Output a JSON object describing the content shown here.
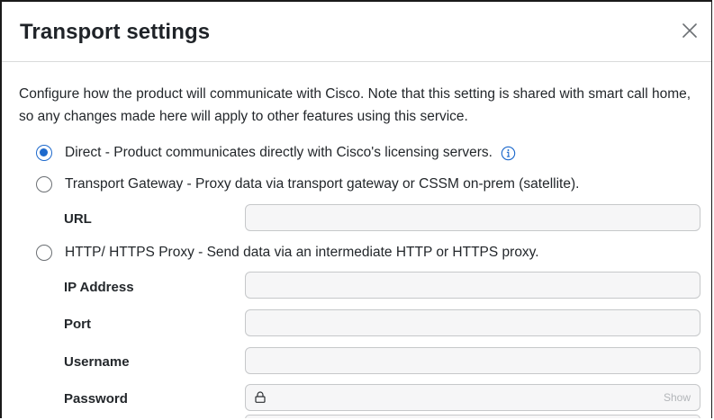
{
  "dialog": {
    "title": "Transport settings",
    "description": "Configure how the product will communicate with Cisco. Note that this setting is shared with smart call home, so any changes made here will apply to other features using this service."
  },
  "options": [
    {
      "label": "Direct - Product communicates directly with Cisco's licensing servers.",
      "selected": true,
      "has_info_icon": true
    },
    {
      "label": "Transport Gateway - Proxy data via transport gateway or CSSM on-prem (satellite).",
      "selected": false
    },
    {
      "label": "HTTP/ HTTPS Proxy - Send data via an intermediate HTTP or HTTPS proxy.",
      "selected": false
    }
  ],
  "fields": {
    "url": {
      "label": "URL",
      "value": "",
      "placeholder": ""
    },
    "ip_address": {
      "label": "IP Address",
      "value": "",
      "placeholder": ""
    },
    "port": {
      "label": "Port",
      "value": "",
      "placeholder": ""
    },
    "username": {
      "label": "Username",
      "value": "",
      "placeholder": ""
    },
    "password": {
      "label": "Password",
      "value": "",
      "placeholder": "",
      "show_label": "Show"
    }
  },
  "colors": {
    "accent": "#1d69cc",
    "text": "#23272b",
    "input_bg": "#f6f6f7",
    "input_border": "#c6c8ca"
  },
  "icons": {
    "close": "close-icon",
    "info": "info-icon",
    "lock": "lock-icon"
  }
}
